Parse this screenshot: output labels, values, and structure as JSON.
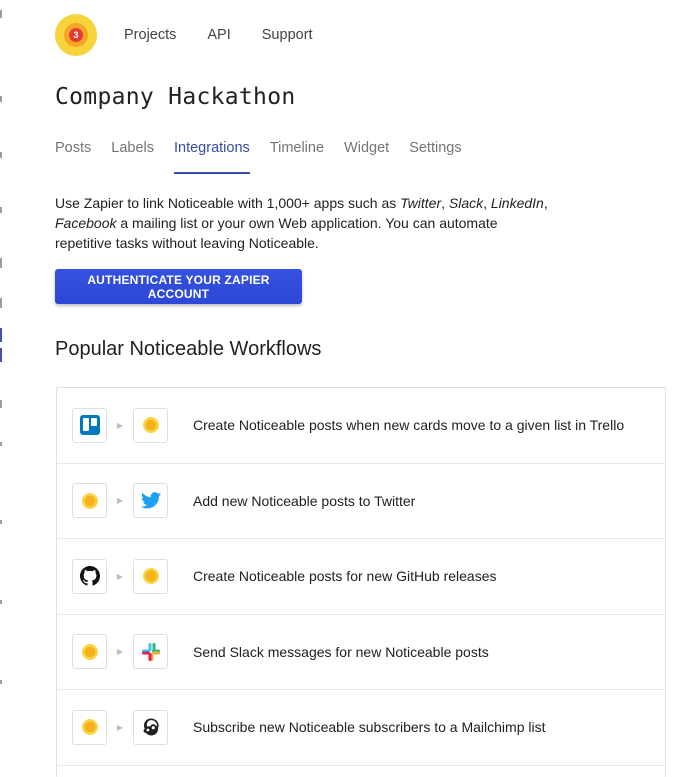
{
  "header": {
    "logo_badge": "3",
    "nav": [
      "Projects",
      "API",
      "Support"
    ]
  },
  "page": {
    "title": "Company Hackathon"
  },
  "tabs": [
    {
      "label": "Posts",
      "active": false
    },
    {
      "label": "Labels",
      "active": false
    },
    {
      "label": "Integrations",
      "active": true
    },
    {
      "label": "Timeline",
      "active": false
    },
    {
      "label": "Widget",
      "active": false
    },
    {
      "label": "Settings",
      "active": false
    }
  ],
  "description": {
    "part1": "Use Zapier to link Noticeable with 1,000+ apps such as ",
    "twitter": "Twitter",
    "sep1": ", ",
    "slack": "Slack",
    "sep2": ", ",
    "linkedin": "LinkedIn",
    "sep3": ", ",
    "facebook": "Facebook",
    "part2": " a mailing list or your own Web application. You can automate repetitive tasks without leaving Noticeable."
  },
  "auth_button": "AUTHENTICATE YOUR ZAPIER ACCOUNT",
  "section_title": "Popular Noticeable Workflows",
  "workflows": [
    {
      "from": "trello-icon",
      "to": "noticeable-icon",
      "text": "Create Noticeable posts when new cards move to a given list in Trello"
    },
    {
      "from": "noticeable-icon",
      "to": "twitter-icon",
      "text": "Add new Noticeable posts to Twitter"
    },
    {
      "from": "github-icon",
      "to": "noticeable-icon",
      "text": "Create Noticeable posts for new GitHub releases"
    },
    {
      "from": "noticeable-icon",
      "to": "slack-icon",
      "text": "Send Slack messages for new Noticeable posts"
    },
    {
      "from": "noticeable-icon",
      "to": "mailchimp-icon",
      "text": "Subscribe new Noticeable subscribers to a Mailchimp list"
    }
  ],
  "colors": {
    "accent": "#3949ab",
    "button": "#2d47d6",
    "logo_yellow": "#f7d43b",
    "badge_red": "#e53935"
  }
}
